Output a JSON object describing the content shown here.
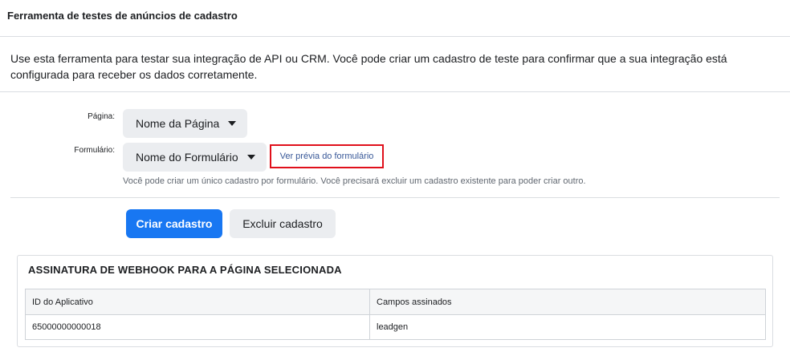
{
  "header": {
    "title": "Ferramenta de testes de anúncios de cadastro"
  },
  "intro": {
    "text": "Use esta ferramenta para testar sua integração de API ou CRM. Você pode criar um cadastro de teste para confirmar que a sua integração está configurada para receber os dados corretamente."
  },
  "form": {
    "page_label": "Página:",
    "page_value": "Nome da Página",
    "form_label": "Formulário:",
    "form_value": "Nome do Formulário",
    "preview_link": "Ver prévia do formulário",
    "help_text": "Você pode criar um único cadastro por formulário. Você precisará excluir um cadastro existente para poder criar outro."
  },
  "actions": {
    "create_label": "Criar cadastro",
    "delete_label": "Excluir cadastro"
  },
  "webhook": {
    "title": "ASSINATURA DE WEBHOOK PARA A PÁGINA SELECIONADA",
    "columns": [
      "ID do Aplicativo",
      "Campos assinados"
    ],
    "rows": [
      [
        "65000000000018",
        "leadgen"
      ]
    ]
  },
  "colors": {
    "primary": "#1877f2",
    "highlight_border": "#e0101b",
    "link": "#385898",
    "button_gray": "#ebedf0"
  }
}
